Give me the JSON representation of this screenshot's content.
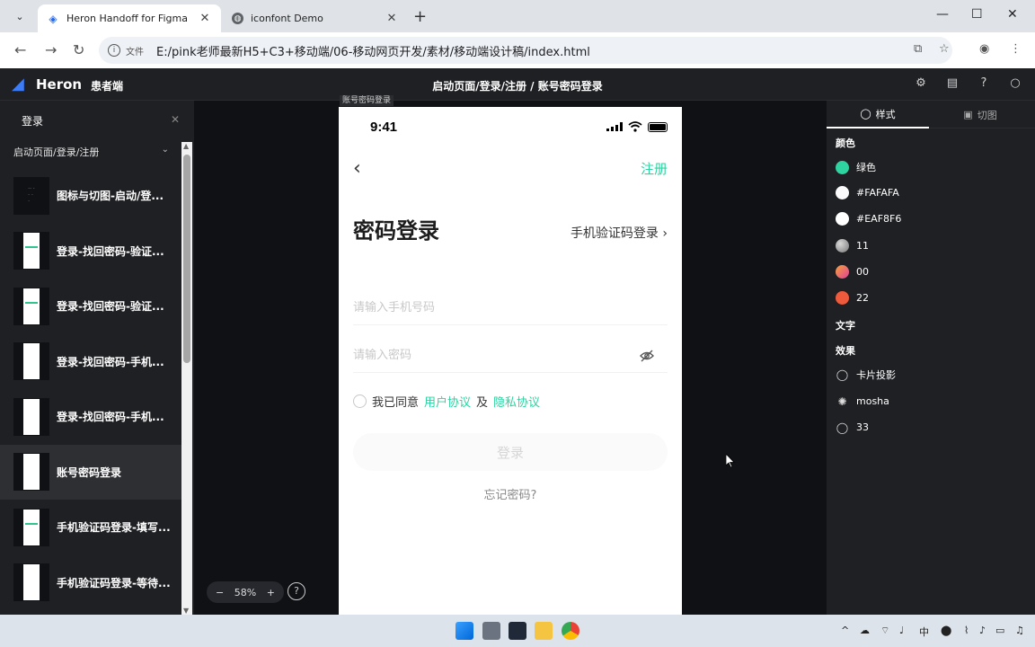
{
  "browser": {
    "tabs": [
      {
        "title": "Heron Handoff for Figma",
        "active": true
      },
      {
        "title": "iconfont Demo",
        "active": false
      }
    ],
    "address": {
      "chip": "文件",
      "url": "E:/pink老师最新H5+C3+移动端/06-移动网页开发/素材/移动端设计稿/index.html"
    }
  },
  "app": {
    "logo": "Heron",
    "project": "患者端",
    "breadcrumb": "启动页面/登录/注册 / 账号密码登录"
  },
  "left_panel": {
    "search_value": "登录",
    "group": "启动页面/登录/注册",
    "pages": [
      {
        "label": "图标与切图-启动/登..."
      },
      {
        "label": "登录-找回密码-验证..."
      },
      {
        "label": "登录-找回密码-验证..."
      },
      {
        "label": "登录-找回密码-手机..."
      },
      {
        "label": "登录-找回密码-手机..."
      },
      {
        "label": "账号密码登录"
      },
      {
        "label": "手机验证码登录-填写..."
      },
      {
        "label": "手机验证码登录-等待..."
      }
    ],
    "selected_index": 5
  },
  "canvas": {
    "frame_label": "账号密码登录",
    "zoom": "58%"
  },
  "phone": {
    "time": "9:41",
    "register": "注册",
    "title": "密码登录",
    "sms_login": "手机验证码登录",
    "phone_placeholder": "请输入手机号码",
    "password_placeholder": "请输入密码",
    "agree_prefix": "我已同意",
    "user_agreement": "用户协议",
    "and": "及",
    "privacy": "隐私协议",
    "login_btn": "登录",
    "forgot": "忘记密码?"
  },
  "right_panel": {
    "tabs": [
      "样式",
      "切图"
    ],
    "colors_title": "颜色",
    "colors": [
      {
        "name": "绿色",
        "color": "#2ed3a0"
      },
      {
        "name": "#FAFAFA",
        "color": "#fafafa"
      },
      {
        "name": "#EAF8F6",
        "color": "#eaf8f6"
      },
      {
        "name": "11",
        "color": "#9a9a9a"
      },
      {
        "name": "00",
        "color": "#ee5a7a"
      },
      {
        "name": "22",
        "color": "#f05a3c"
      }
    ],
    "text_title": "文字",
    "effects_title": "效果",
    "effects": [
      {
        "name": "卡片投影",
        "icon": "shadow-icon"
      },
      {
        "name": "mosha",
        "icon": "blur-icon"
      },
      {
        "name": "33",
        "icon": "shadow-icon"
      }
    ]
  },
  "taskbar": {
    "ime": "中"
  }
}
